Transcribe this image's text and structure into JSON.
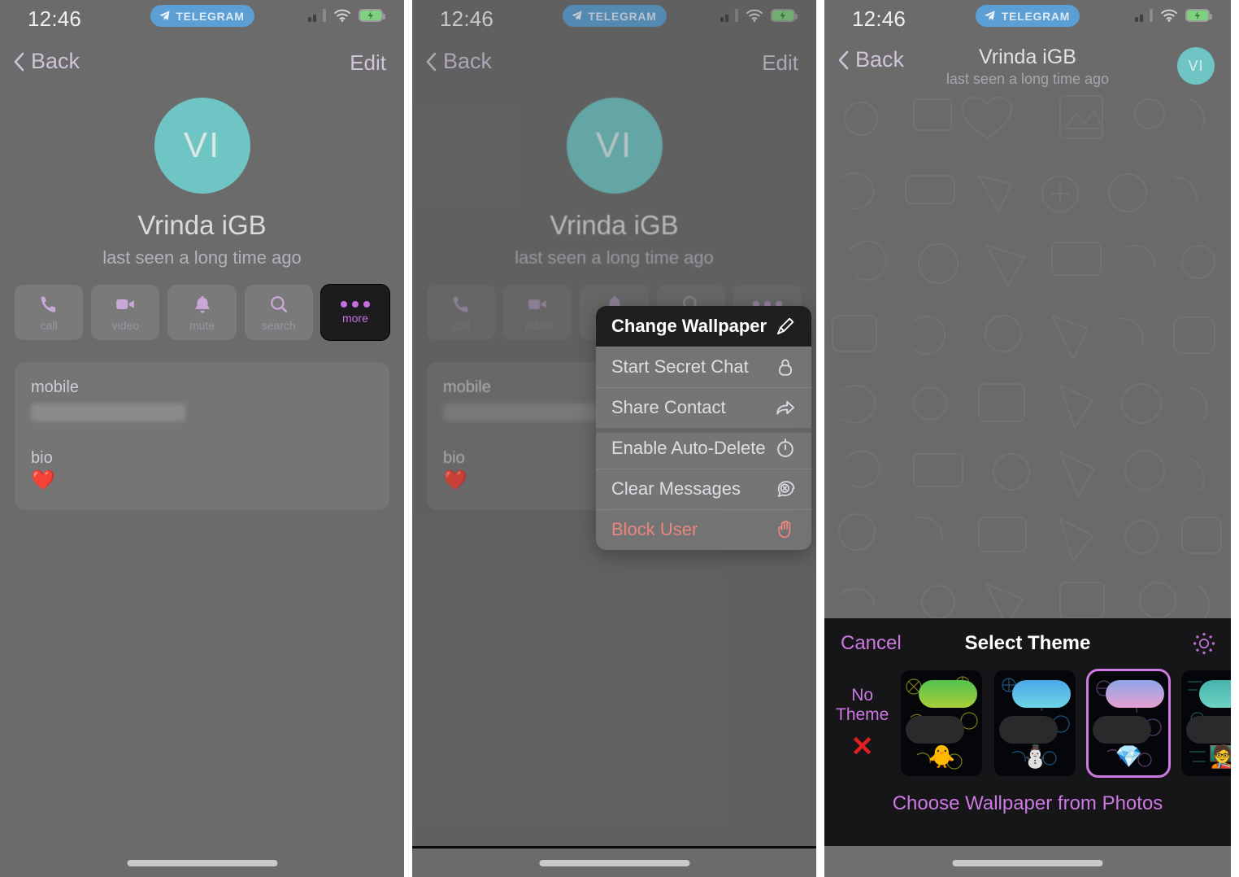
{
  "status_bar": {
    "time": "12:46",
    "app_badge": "TELEGRAM",
    "icons": [
      "signal-icon",
      "wifi-icon",
      "battery-charging-icon"
    ]
  },
  "nav": {
    "back_label": "Back",
    "edit_label": "Edit"
  },
  "profile": {
    "avatar_initials": "VI",
    "avatar_color": "#6fc5c3",
    "name": "Vrinda iGB",
    "status": "last seen a long time ago"
  },
  "actions": [
    {
      "label": "call",
      "icon": "phone-icon"
    },
    {
      "label": "video",
      "icon": "video-camera-icon"
    },
    {
      "label": "mute",
      "icon": "bell-icon"
    },
    {
      "label": "search",
      "icon": "magnifier-icon"
    },
    {
      "label": "more",
      "icon": "ellipsis-icon",
      "selected": true
    }
  ],
  "info_card": {
    "phone_label": "mobile",
    "phone_value": "",
    "bio_label": "bio",
    "bio_value": "❤️"
  },
  "context_menu": [
    {
      "label": "Change Wallpaper",
      "icon": "brush-icon",
      "highlighted": true
    },
    {
      "label": "Start Secret Chat",
      "icon": "lock-icon"
    },
    {
      "label": "Share Contact",
      "icon": "share-arrow-icon"
    },
    {
      "label": "Enable Auto-Delete",
      "icon": "timer-icon",
      "group_start": true
    },
    {
      "label": "Clear Messages",
      "icon": "clear-chat-icon"
    },
    {
      "label": "Block User",
      "icon": "stop-hand-icon",
      "danger": true
    }
  ],
  "chat_header": {
    "back_label": "Back",
    "title": "Vrinda iGB",
    "subtitle": "last seen a long time ago",
    "avatar_initials": "VI"
  },
  "theme_sheet": {
    "cancel_label": "Cancel",
    "title": "Select Theme",
    "brightness_icon": "sun-icon",
    "no_theme_label_line1": "No",
    "no_theme_label_line2": "Theme",
    "no_theme_mark": "✕",
    "accent_color": "#cc79e2",
    "themes": [
      {
        "emoji": "🐥",
        "bubble_from": "#54c24e",
        "bubble_to": "#a8cf3a",
        "pattern_color": "#b9b32a",
        "selected": false
      },
      {
        "emoji": "⛄",
        "bubble_from": "#4aa8e8",
        "bubble_to": "#6fd3e6",
        "pattern_color": "#2a7fb9",
        "selected": false
      },
      {
        "emoji": "💎",
        "bubble_from": "#8ea6e8",
        "bubble_to": "#e59fd0",
        "pattern_color": "#7a4f8f",
        "selected": true
      },
      {
        "emoji": "🧑‍🏫",
        "bubble_from": "#45b3ac",
        "bubble_to": "#6fd2c4",
        "pattern_color": "#2f7f78",
        "selected": false
      }
    ],
    "choose_wallpaper_label": "Choose Wallpaper from Photos"
  }
}
